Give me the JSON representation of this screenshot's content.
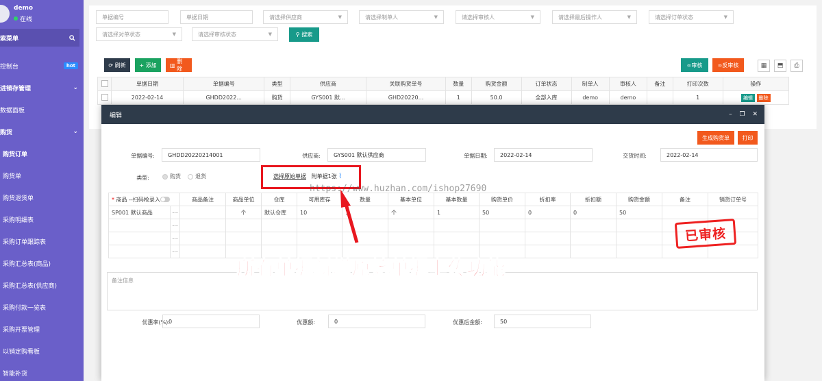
{
  "sidebar": {
    "user_name": "demo",
    "user_status": "在线",
    "search_menu": "索菜单",
    "items": [
      {
        "label": "控制台",
        "badge": "hot"
      },
      {
        "label": "进销存管理"
      },
      {
        "label": "数据面板"
      },
      {
        "label": "购货"
      },
      {
        "label": "购货订单"
      },
      {
        "label": "购货单"
      },
      {
        "label": "购货退货单"
      },
      {
        "label": "采购明细表"
      },
      {
        "label": "采购订单跟踪表"
      },
      {
        "label": "采购汇总表(商品)"
      },
      {
        "label": "采购汇总表(供应商)"
      },
      {
        "label": "采购付款一览表"
      },
      {
        "label": "采购开票管理"
      },
      {
        "label": "以销定购看板"
      },
      {
        "label": "智能补货"
      }
    ]
  },
  "filters": {
    "doc_no": "单据编号",
    "doc_date": "单据日期",
    "supplier": "请选择供应商",
    "maker": "请选择制单人",
    "auditor": "请选择审核人",
    "last_operator": "请选择最后操作人",
    "order_status": "请选择订单状态",
    "reconcile_status": "请选择对单状态",
    "audit_status": "请选择审核状态",
    "search": "搜索"
  },
  "toolbar": {
    "refresh": "刷新",
    "add": "添加",
    "delete": "删除",
    "audit": "审核",
    "unaudit": "反审核"
  },
  "list_table": {
    "headers": [
      "单据日期",
      "单据编号",
      "类型",
      "供应商",
      "关联购货单号",
      "数量",
      "购货金额",
      "订单状态",
      "制单人",
      "审核人",
      "备注",
      "打印次数",
      "操作"
    ],
    "row": [
      "2022-02-14",
      "GHDD2022...",
      "购货",
      "GYS001 默...",
      "GHD20220...",
      "1",
      "50.0",
      "全部入库",
      "demo",
      "demo",
      "",
      "1"
    ],
    "edit": "编辑",
    "del": "删除"
  },
  "modal": {
    "title": "编辑",
    "gen_btn": "生成购货单",
    "print_btn": "打印",
    "doc_no_label": "单据编号:",
    "doc_no": "GHDD20220214001",
    "supplier_label": "供应商:",
    "supplier": "GYS001 默认供应商",
    "doc_date_label": "单据日期:",
    "doc_date": "2022-02-14",
    "delivery_label": "交货时间:",
    "delivery": "2022-02-14",
    "type_label": "类型:",
    "type_opt1": "购货",
    "type_opt2": "退货",
    "attach_link": "选择原始单据",
    "attach_count": "附单据1张",
    "table_headers": [
      "商品 --扫码枪录入",
      "商品备注",
      "商品单位",
      "仓库",
      "可用库存",
      "数量",
      "基本单位",
      "基本数量",
      "购货单价",
      "折扣率",
      "折扣额",
      "购货金额",
      "备注",
      "销货订单号"
    ],
    "row": [
      "SP001 默认商品",
      "个",
      "默认仓库",
      "10",
      "1",
      "个",
      "1",
      "50",
      "0",
      "0",
      "50"
    ],
    "remark_placeholder": "备注信息",
    "disc_rate_label": "优惠率(%):",
    "disc_rate": "0",
    "disc_amt_label": "优惠额:",
    "disc_amt": "0",
    "after_label": "优惠后金额:",
    "after": "50"
  },
  "overlay": {
    "watermark": "https://www.huzhan.com/ishop27690",
    "stamp": "已审核",
    "caption": "所有单据新增原始单据上传功能"
  },
  "colors": {
    "sidebar": "#6a5fc9",
    "teal": "#179a8a",
    "green": "#1aa260",
    "orange": "#f2591d",
    "modal_header": "#2e3b4a",
    "highlight": "#e8171f"
  }
}
